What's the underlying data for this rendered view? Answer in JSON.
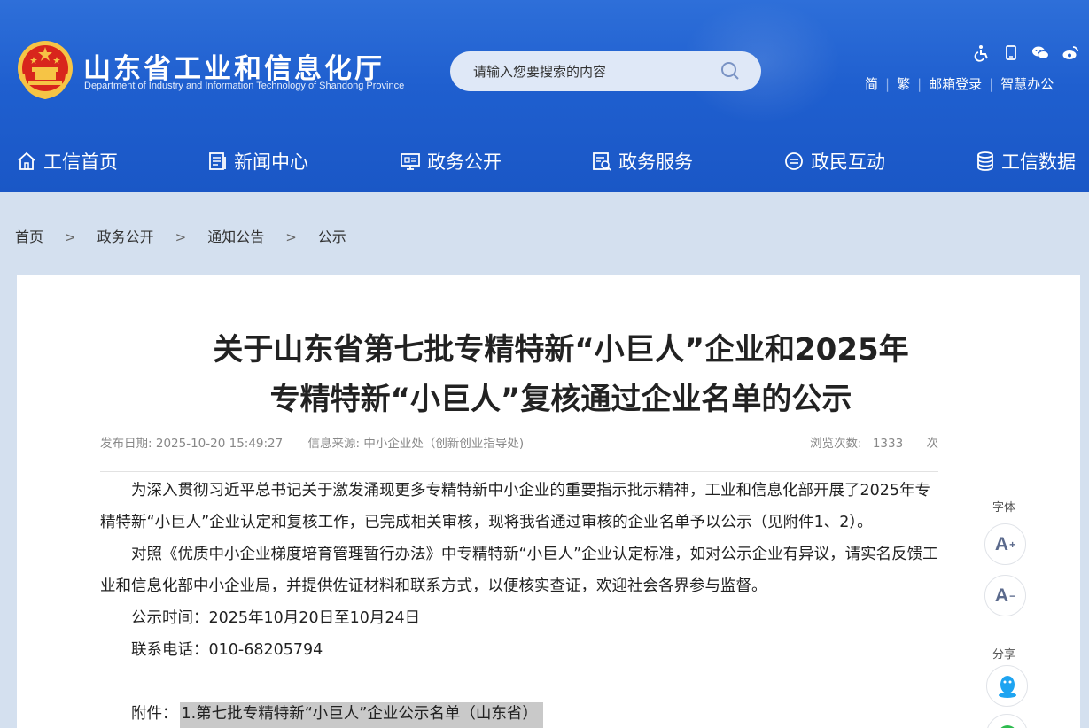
{
  "header": {
    "title": "山东省工业和信息化厅",
    "subtitle": "Department of Industry and Information Technology of Shandong Province",
    "search_placeholder": "请输入您要搜索的内容",
    "icons": [
      "accessibility-icon",
      "mobile-icon",
      "wechat-icon",
      "weibo-icon"
    ],
    "links": [
      "简",
      "繁",
      "邮箱登录",
      "智慧办公"
    ]
  },
  "nav": [
    {
      "label": "工信首页",
      "icon": "home-icon"
    },
    {
      "label": "新闻中心",
      "icon": "news-icon"
    },
    {
      "label": "政务公开",
      "icon": "monitor-icon"
    },
    {
      "label": "政务服务",
      "icon": "service-icon"
    },
    {
      "label": "政民互动",
      "icon": "chat-icon"
    },
    {
      "label": "工信数据",
      "icon": "database-icon"
    }
  ],
  "breadcrumb": {
    "items": [
      "首页",
      "政务公开",
      "通知公告",
      "公示"
    ],
    "separator": ">"
  },
  "article": {
    "title_line1": "关于山东省第七批专精特新“小巨人”企业和2025年",
    "title_line2": "专精特新“小巨人”复核通过企业名单的公示",
    "publish_label": "发布日期:",
    "publish_date": "2025-10-20 15:49:27",
    "source_label": "信息来源:",
    "source": "中小企业处（创新创业指导处)",
    "views_label": "浏览次数:",
    "views": "1333",
    "views_unit": "次",
    "paragraphs": [
      "为深入贯彻习近平总书记关于激发涌现更多专精特新中小企业的重要指示批示精神，工业和信息化部开展了2025年专精特新“小巨人”企业认定和复核工作，已完成相关审核，现将我省通过审核的企业名单予以公示（见附件1、2）。",
      "对照《优质中小企业梯度培育管理暂行办法》中专精特新“小巨人”企业认定标准，如对公示企业有异议，请实名反馈工业和信息化部中小企业局，并提供佐证材料和联系方式，以便核实查证，欢迎社会各界参与监督。",
      "公示时间：2025年10月20日至10月24日",
      "联系电话：010-68205794"
    ],
    "attachment_label": "附件：",
    "attachment_link": "1.第七批专精特新“小巨人”企业公示名单（山东省）"
  },
  "side_tools": {
    "font_label": "字体",
    "font_increase": "A",
    "font_decrease": "A",
    "share_label": "分享",
    "share_icons": [
      "qq-icon",
      "wechat-share-icon"
    ]
  },
  "colors": {
    "header_blue": "#1f5fcf",
    "page_bg": "#d4e0ef",
    "link_highlight": "#c9c9c9"
  }
}
